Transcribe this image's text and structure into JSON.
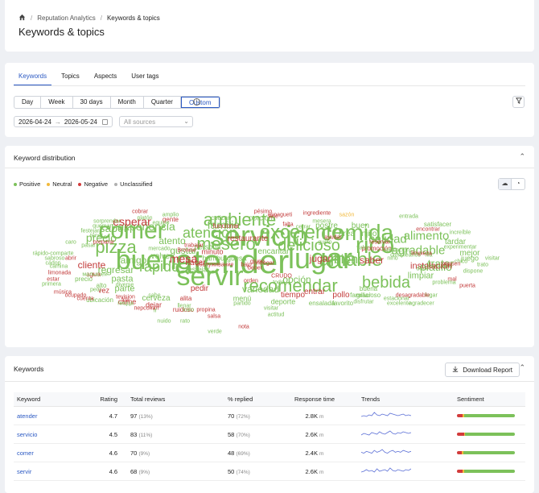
{
  "breadcrumb": {
    "section": "Reputation Analytics",
    "current": "Keywords & topics"
  },
  "page_title": "Keywords & topics",
  "tabs": [
    {
      "label": "Keywords",
      "active": true
    },
    {
      "label": "Topics",
      "active": false
    },
    {
      "label": "Aspects",
      "active": false
    },
    {
      "label": "User tags",
      "active": false
    }
  ],
  "periods": [
    {
      "label": "Day",
      "active": false
    },
    {
      "label": "Week",
      "active": false
    },
    {
      "label": "30 days",
      "active": false
    },
    {
      "label": "Month",
      "active": false
    },
    {
      "label": "Quarter",
      "active": false
    },
    {
      "label": "Custom",
      "active": true
    }
  ],
  "date_range": {
    "start": "2026-04-24",
    "end": "2026-05-24"
  },
  "sources": {
    "placeholder": "All sources"
  },
  "distribution": {
    "title": "Keyword distribution",
    "legend": [
      {
        "label": "Positive",
        "color": "#7cc15a"
      },
      {
        "label": "Neutral",
        "color": "#f2b93b"
      },
      {
        "label": "Negative",
        "color": "#d23b3b"
      },
      {
        "label": "Unclassified",
        "color": "#b0b0b0"
      }
    ]
  },
  "cloud_words": [
    [
      "atender",
      "pos"
    ],
    [
      "servicio",
      "pos"
    ],
    [
      "comida",
      "pos"
    ],
    [
      "lugar",
      "pos"
    ],
    [
      "bueno",
      "pos"
    ],
    [
      "servir",
      "pos"
    ],
    [
      "rico",
      "pos"
    ],
    [
      "comer",
      "pos"
    ],
    [
      "ambiente",
      "pos"
    ],
    [
      "excelente",
      "pos"
    ],
    [
      "amable",
      "pos"
    ],
    [
      "recomendar",
      "pos"
    ],
    [
      "mesero",
      "pos"
    ],
    [
      "atención",
      "pos"
    ],
    [
      "pizza",
      "pos"
    ],
    [
      "delicioso",
      "pos"
    ],
    [
      "bebida",
      "pos"
    ],
    [
      "rápido",
      "pos"
    ],
    [
      "agradable",
      "pos"
    ],
    [
      "calidad",
      "pos"
    ],
    [
      "alimento",
      "pos"
    ],
    [
      "familia",
      "pos"
    ],
    [
      "experiencia",
      "pos"
    ],
    [
      "esperar",
      "neg"
    ],
    [
      "mesa",
      "neg"
    ],
    [
      "sabor",
      "pos"
    ],
    [
      "precio",
      "pos"
    ],
    [
      "bien",
      "pos"
    ],
    [
      "jugar",
      "neg"
    ],
    [
      "saber",
      "neg"
    ],
    [
      "platillo",
      "pos"
    ],
    [
      "tratar",
      "pos"
    ],
    [
      "amigo",
      "pos"
    ],
    [
      "gustar",
      "pos"
    ],
    [
      "atento",
      "pos"
    ],
    [
      "minuto",
      "neg"
    ],
    [
      "cliente",
      "neg"
    ],
    [
      "regresar",
      "pos"
    ],
    [
      "variedad",
      "pos"
    ],
    [
      "opción",
      "pos"
    ],
    [
      "tiempo",
      "neg"
    ],
    [
      "pollo",
      "neg"
    ],
    [
      "entrar",
      "neg"
    ],
    [
      "pasta",
      "pos"
    ],
    [
      "parte",
      "pos"
    ],
    [
      "volver",
      "pos"
    ],
    [
      "hacer",
      "neg"
    ],
    [
      "pedir",
      "neg"
    ],
    [
      "cerveza",
      "pos"
    ],
    [
      "restaurante",
      "neg"
    ],
    [
      "encantar",
      "pos"
    ],
    [
      "área",
      "pos"
    ],
    [
      "buen",
      "pos"
    ],
    [
      "niño",
      "pos"
    ],
    [
      "postre",
      "pos"
    ],
    [
      "porción",
      "pos"
    ],
    [
      "limpiar",
      "pos"
    ],
    [
      "instalación",
      "neg"
    ],
    [
      "mejor",
      "pos"
    ],
    [
      "tardar",
      "pos"
    ],
    [
      "juego",
      "pos"
    ],
    [
      "hamburguesa",
      "pos"
    ],
    [
      "persona",
      "pos"
    ],
    [
      "festejar",
      "pos"
    ],
    [
      "carne",
      "neg"
    ],
    [
      "dejar",
      "neg"
    ],
    [
      "alita",
      "neg"
    ],
    [
      "menú",
      "pos"
    ],
    [
      "deporte",
      "pos"
    ],
    [
      "ensalada",
      "pos"
    ],
    [
      "familiar",
      "pos"
    ],
    [
      "favorito",
      "pos"
    ],
    [
      "ruidoso",
      "neg"
    ],
    [
      "gente",
      "neg"
    ],
    [
      "cotizar",
      "pos"
    ],
    [
      "espagueti",
      "neg"
    ],
    [
      "pésimo",
      "neg"
    ],
    [
      "ingrediente",
      "neg"
    ],
    [
      "entrada",
      "pos"
    ],
    [
      "sazón",
      "neu"
    ],
    [
      "satisfacer",
      "pos"
    ],
    [
      "funcionar",
      "neg"
    ],
    [
      "promoción",
      "neg"
    ],
    [
      "calificación",
      "pos"
    ],
    [
      "reservar",
      "neg"
    ],
    [
      "cumpleaños",
      "pos"
    ],
    [
      "fila",
      "pos"
    ],
    [
      "chico",
      "pos"
    ],
    [
      "vez",
      "neg"
    ],
    [
      "alto",
      "pos"
    ],
    [
      "precio",
      "pos"
    ],
    [
      "agua",
      "neg"
    ],
    [
      "caro",
      "pos"
    ],
    [
      "abrir",
      "neg"
    ],
    [
      "estar",
      "neg"
    ],
    [
      "propina",
      "neg"
    ],
    [
      "trato",
      "pos"
    ],
    [
      "nuido",
      "pos"
    ],
    [
      "visitar",
      "pos"
    ],
    [
      "actitud",
      "pos"
    ],
    [
      "partido",
      "pos"
    ],
    [
      "пицца",
      "pos"
    ],
    [
      "персонал",
      "neg"
    ],
    [
      "tevision",
      "neg"
    ],
    [
      "ubicación",
      "pos"
    ],
    [
      "ocupado",
      "neg"
    ],
    [
      "cuenta",
      "neg"
    ],
    [
      "música",
      "neg"
    ],
    [
      "primera",
      "pos"
    ],
    [
      "limonada",
      "neg"
    ],
    [
      "cádop",
      "pos"
    ],
    [
      "disfrutar",
      "pos"
    ],
    [
      "gracioso",
      "pos"
    ],
    [
      "buena",
      "pos"
    ],
    [
      "lugar",
      "pos"
    ],
    [
      "desagradable",
      "neg"
    ],
    [
      "agradecer",
      "pos"
    ],
    [
      "excelente",
      "pos"
    ],
    [
      "estacionar",
      "pos"
    ],
    [
      "problema",
      "pos"
    ],
    [
      "puerta",
      "neg"
    ],
    [
      "dispone",
      "pos"
    ],
    [
      "trato",
      "pos"
    ],
    [
      "visitar",
      "pos"
    ],
    [
      "gusto",
      "pos"
    ],
    [
      "experimentar",
      "pos"
    ],
    [
      "increíble",
      "pos"
    ],
    [
      "encontrar",
      "neg"
    ],
    [
      "cobrar",
      "neg"
    ],
    [
      "amplio",
      "pos"
    ],
    [
      "platón",
      "pos"
    ],
    [
      "equipo",
      "pos"
    ],
    [
      "sorprender",
      "pos"
    ],
    [
      "quemar",
      "pos"
    ],
    [
      "festejar",
      "pos"
    ],
    [
      "tener",
      "pos"
    ],
    [
      "preparar",
      "neg"
    ],
    [
      "pasar",
      "pos"
    ],
    [
      "rápido-comparte",
      "pos"
    ],
    [
      "sabroso",
      "pos"
    ],
    [
      "camina",
      "pos"
    ],
    [
      "mercado",
      "pos"
    ],
    [
      "обслуживание",
      "neg"
    ],
    [
      "bajo",
      "neg"
    ],
    [
      "grupo",
      "neg"
    ],
    [
      "orden",
      "neg"
    ],
    [
      "todo",
      "pos"
    ],
    [
      "CRUDO",
      "neg"
    ],
    [
      "Browse",
      "neg"
    ],
    [
      "trabajar",
      "neg"
    ],
    [
      "beber",
      "neg"
    ],
    [
      "entregar",
      "neg"
    ],
    [
      "falta",
      "neg"
    ],
    [
      "mesera",
      "pos"
    ],
    [
      "limpieza",
      "neg"
    ],
    [
      "cepsen",
      "neg"
    ],
    [
      "малышей",
      "pos"
    ],
    [
      "diverse",
      "pos"
    ],
    [
      "sabe",
      "pos"
    ],
    [
      "llenar",
      "pos"
    ],
    [
      "salsa",
      "neg"
    ],
    [
      "nota",
      "neg"
    ],
    [
      "arte",
      "neg"
    ],
    [
      "cerrar",
      "pos"
    ],
    [
      "ayudar",
      "neg"
    ],
    [
      "valer",
      "pos"
    ],
    [
      "niño",
      "pos"
    ],
    [
      "decir",
      "pos"
    ],
    [
      "mal",
      "neg"
    ],
    [
      "peor",
      "pos"
    ],
    [
      "fría",
      "neg"
    ],
    [
      "ir",
      "pos"
    ],
    [
      "rato",
      "pos"
    ],
    [
      "verde",
      "pos"
    ]
  ],
  "keywords_section": {
    "title": "Keywords",
    "download_label": "Download Report",
    "headers": [
      "Keyword",
      "Rating",
      "Total reviews",
      "% replied",
      "Response time",
      "Trends",
      "Sentiment"
    ],
    "rows": [
      {
        "keyword": "atender",
        "rating": "4.7",
        "reviews": "97",
        "reviews_pct": "(13%)",
        "replied": "70",
        "replied_pct": "(72%)",
        "response": "2.8K",
        "unit": "m",
        "trend": [
          3,
          4,
          3,
          5,
          4,
          8,
          5,
          4,
          6,
          5,
          4,
          7,
          6,
          5,
          4,
          5,
          6,
          4,
          5,
          4
        ],
        "sentiment": {
          "neg": 0.1,
          "neu": 0.02,
          "pos": 0.88
        }
      },
      {
        "keyword": "servicio",
        "rating": "4.5",
        "reviews": "83",
        "reviews_pct": "(11%)",
        "replied": "58",
        "replied_pct": "(70%)",
        "response": "2.6K",
        "unit": "m",
        "trend": [
          3,
          5,
          4,
          3,
          6,
          5,
          4,
          7,
          5,
          4,
          6,
          8,
          5,
          4,
          6,
          5,
          7,
          6,
          5,
          6
        ],
        "sentiment": {
          "neg": 0.12,
          "neu": 0.02,
          "pos": 0.86
        }
      },
      {
        "keyword": "comer",
        "rating": "4.6",
        "reviews": "70",
        "reviews_pct": "(9%)",
        "replied": "48",
        "replied_pct": "(69%)",
        "response": "2.4K",
        "unit": "m",
        "trend": [
          4,
          3,
          5,
          4,
          3,
          6,
          4,
          5,
          7,
          4,
          3,
          5,
          6,
          4,
          5,
          4,
          6,
          5,
          4,
          5
        ],
        "sentiment": {
          "neg": 0.09,
          "neu": 0.02,
          "pos": 0.89
        }
      },
      {
        "keyword": "servir",
        "rating": "4.6",
        "reviews": "68",
        "reviews_pct": "(9%)",
        "replied": "50",
        "replied_pct": "(74%)",
        "response": "2.6K",
        "unit": "m",
        "trend": [
          3,
          4,
          6,
          4,
          5,
          3,
          7,
          4,
          5,
          6,
          4,
          8,
          5,
          4,
          6,
          5,
          4,
          6,
          5,
          7
        ],
        "sentiment": {
          "neg": 0.1,
          "neu": 0.02,
          "pos": 0.88
        }
      }
    ]
  }
}
